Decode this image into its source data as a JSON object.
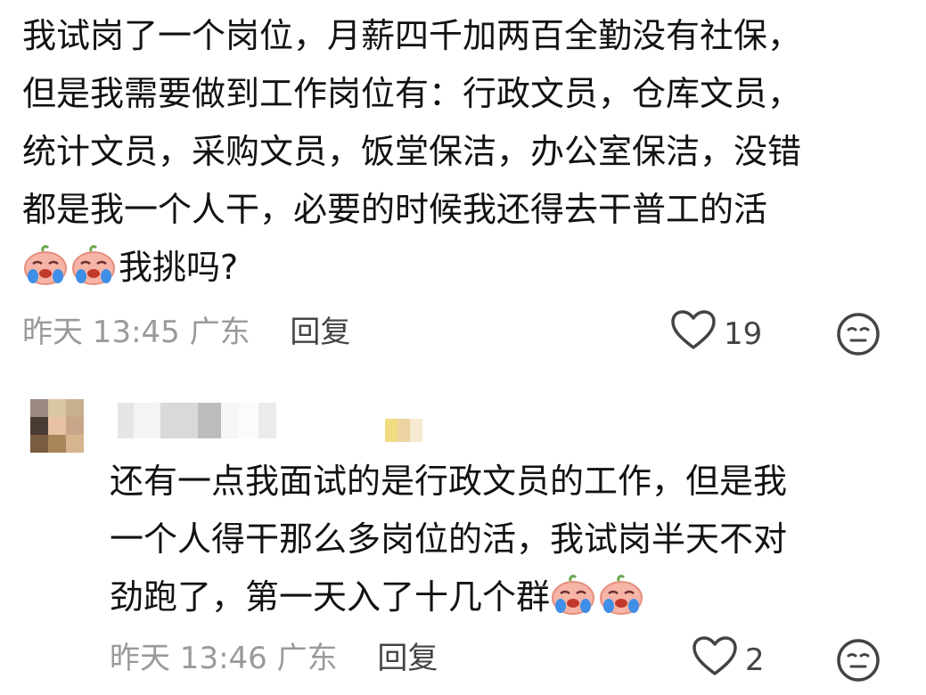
{
  "comment1": {
    "lines": [
      "我试岗了一个岗位，月薪四千加两百全勤没有社保，",
      "但是我需要做到工作岗位有：行政文员，仓库文员，",
      "统计文员，采购文员，饭堂保洁，办公室保洁，没错",
      "都是我一个人干，必要的时候我还得去干普工的活"
    ],
    "last_line_text": "我挑吗?",
    "last_line_emojis": [
      "crying-face-emoji",
      "crying-face-emoji"
    ],
    "time": "昨天 13:45",
    "location": "广东",
    "reply_label": "回复",
    "likes": "19"
  },
  "comment2": {
    "lines": [
      "还有一点我面试的是行政文员的工作，但是我",
      "一个人得干那么多岗位的活，我试岗半天不对"
    ],
    "last_line_text": "劲跑了，第一天入了十几个群",
    "last_line_emojis": [
      "crying-face-emoji",
      "crying-face-emoji"
    ],
    "time": "昨天 13:46",
    "location": "广东",
    "reply_label": "回复",
    "likes": "2"
  },
  "icons": {
    "like": "heart-outline-icon",
    "reaction": "neutral-face-icon"
  },
  "colors": {
    "text": "#121212",
    "meta": "#9a9a9a",
    "reply": "#444444",
    "emoji_skin": "#f6b4a6",
    "emoji_tear": "#3f8fe8"
  }
}
